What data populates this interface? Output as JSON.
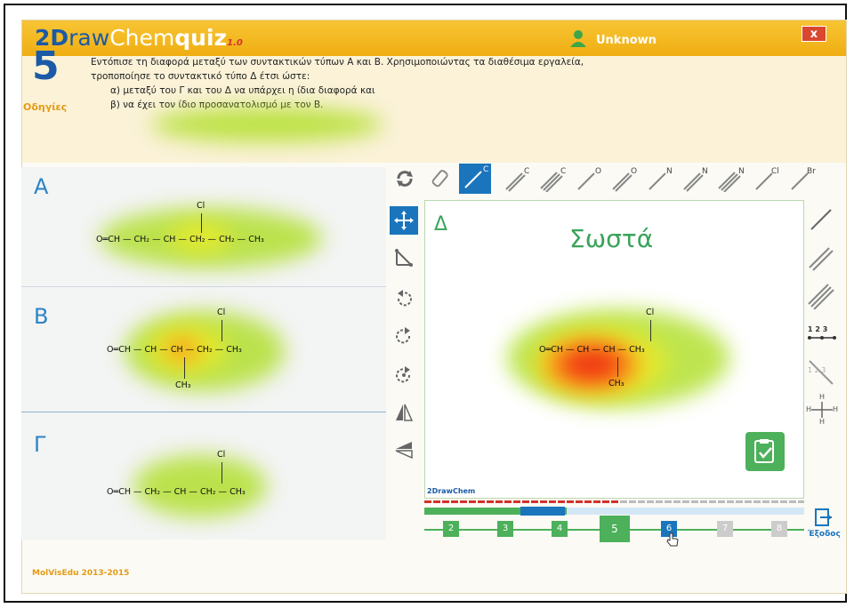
{
  "app": {
    "logo_prefix": "2D",
    "logo_mid": "raw",
    "logo_chem": "Chem",
    "logo_quiz": "quiz",
    "logo_version": "1.0",
    "user": "Unknown",
    "close_label": "x"
  },
  "instructions": {
    "step": "5",
    "label": "Οδηγίες",
    "line1": "Εντόπισε τη διαφορά μεταξύ των συντακτικών τύπων Α και Β. Χρησιμοποιώντας τα διαθέσιμα εργαλεία,",
    "line2": "τροποποίησε το συντακτικό τύπο Δ έτσι ώστε:",
    "line3": "α) μεταξύ του Γ και του Δ να υπάρχει η ίδια διαφορά και",
    "line4": "β) να έχει τον ίδιο προσανατολισμό με τον Β."
  },
  "panels": {
    "a": {
      "label": "A",
      "formula": "O═CH — CH₂ — CH — CH₂ — CH₂ — CH₃",
      "sub": "Cl"
    },
    "b": {
      "label": "B",
      "formula": "O═CH — CH — CH — CH₂ — CH₃",
      "sub_top": "Cl",
      "sub_bottom": "CH₃"
    },
    "g": {
      "label": "Γ",
      "formula": "O═CH — CH₂ — CH — CH₂ — CH₃",
      "sub": "Cl"
    }
  },
  "editor": {
    "label": "Δ",
    "status": "Σωστά",
    "formula": "O═CH — CH — CH — CH₃",
    "sub_top": "Cl",
    "sub_bottom": "CH₃",
    "brand": "2DrawChem"
  },
  "top_tools": [
    "rotate-icon",
    "eraser-icon",
    "single-bond-c-icon",
    "double-bond-c-icon",
    "triple-bond-c-icon",
    "bond-o-icon",
    "double-bond-o-icon",
    "bond-n-icon",
    "double-bond-n-icon",
    "triple-bond-n-icon",
    "bond-cl-icon",
    "bond-br-icon"
  ],
  "top_tool_labels": [
    "",
    "",
    "C",
    "C",
    "C",
    "O",
    "O",
    "N",
    "N",
    "N",
    "Cl",
    "Br"
  ],
  "left_tools": [
    "move-icon",
    "angle-icon",
    "rotate-ccw-icon",
    "rotate-cw-icon",
    "rotate-90-icon",
    "flip-vertical-icon",
    "flip-horizontal-icon"
  ],
  "right_tools": [
    "single-bond-icon",
    "double-bond-icon",
    "triple-bond-icon",
    "numbering-icon",
    "numbering-off-icon",
    "hydrogen-icon"
  ],
  "right_tool_labels": [
    "",
    "",
    "",
    "1 2 3",
    "1 2 3",
    "H"
  ],
  "steps": [
    "2",
    "3",
    "4",
    "5",
    "6",
    "7",
    "8"
  ],
  "current_step": "5",
  "exit_label": "Έξοδος",
  "footer": "MolVisEdu 2013-2015",
  "colors": {
    "title_bar": "#f2b51f",
    "accent_blue": "#1b75bc",
    "green": "#4db05a"
  }
}
